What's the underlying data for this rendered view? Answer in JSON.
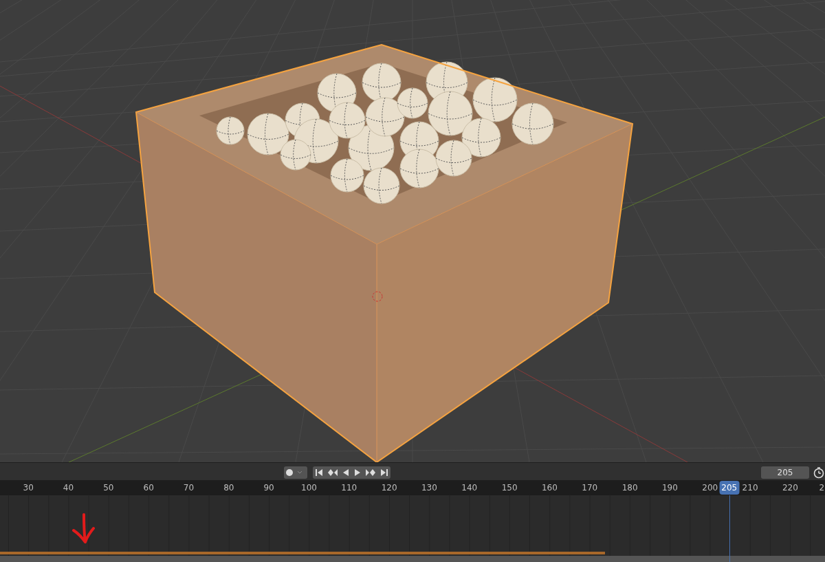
{
  "timeline": {
    "current_frame": "205",
    "ruler_labels": [
      "30",
      "40",
      "50",
      "60",
      "70",
      "80",
      "90",
      "100",
      "110",
      "120",
      "130",
      "140",
      "150",
      "160",
      "170",
      "180",
      "190",
      "200",
      "210",
      "220",
      "2"
    ],
    "playhead": {
      "label": "205",
      "level": 0.884
    },
    "cache_bar": {
      "level": 0.733
    }
  }
}
